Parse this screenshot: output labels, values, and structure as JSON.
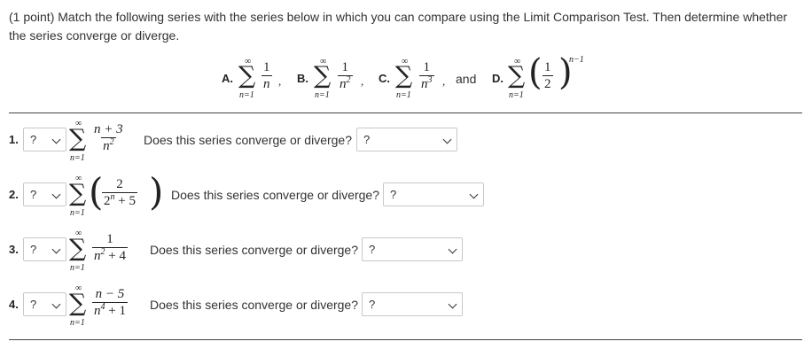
{
  "intro": {
    "text": "(1 point) Match the following series with the series below in which you can compare using the Limit Comparison Test. Then determine whether the series converge or diverge."
  },
  "options": {
    "sum_top": "∞",
    "sum_bottom": "n=1",
    "sigma": "∑",
    "a": {
      "letter": "A.",
      "num": "1",
      "den": "n",
      "trail": ","
    },
    "b": {
      "letter": "B.",
      "num": "1",
      "den_base": "n",
      "den_exp": "2",
      "trail": ","
    },
    "c": {
      "letter": "C.",
      "num": "1",
      "den_base": "n",
      "den_exp": "3",
      "trail": ","
    },
    "and_text": "and",
    "d": {
      "letter": "D.",
      "num": "1",
      "den": "2",
      "exp": "n−1"
    }
  },
  "questions": [
    {
      "number": "1.",
      "select_value": "?",
      "num": "n + 3",
      "den_base": "n",
      "den_exp": "2",
      "prompt": "Does this series converge or diverge?",
      "cd_value": "?"
    },
    {
      "number": "2.",
      "select_value": "?",
      "num": "2",
      "den_base": "2",
      "den_exp": "n",
      "den_tail": " + 5",
      "prompt": "Does this series converge or diverge?",
      "cd_value": "?"
    },
    {
      "number": "3.",
      "select_value": "?",
      "num": "1",
      "den_base": "n",
      "den_exp": "2",
      "den_tail": " + 4",
      "prompt": "Does this series converge or diverge?",
      "cd_value": "?"
    },
    {
      "number": "4.",
      "select_value": "?",
      "num": "n − 5",
      "den_base": "n",
      "den_exp": "4",
      "den_tail": " + 1",
      "prompt": "Does this series converge or diverge?",
      "cd_value": "?"
    }
  ],
  "icons": {
    "dropdown": "chevron-down-icon",
    "sum": "sigma-icon"
  },
  "colors": {
    "text": "#333333",
    "rule": "#444444",
    "select_border": "#c8c8c8"
  }
}
